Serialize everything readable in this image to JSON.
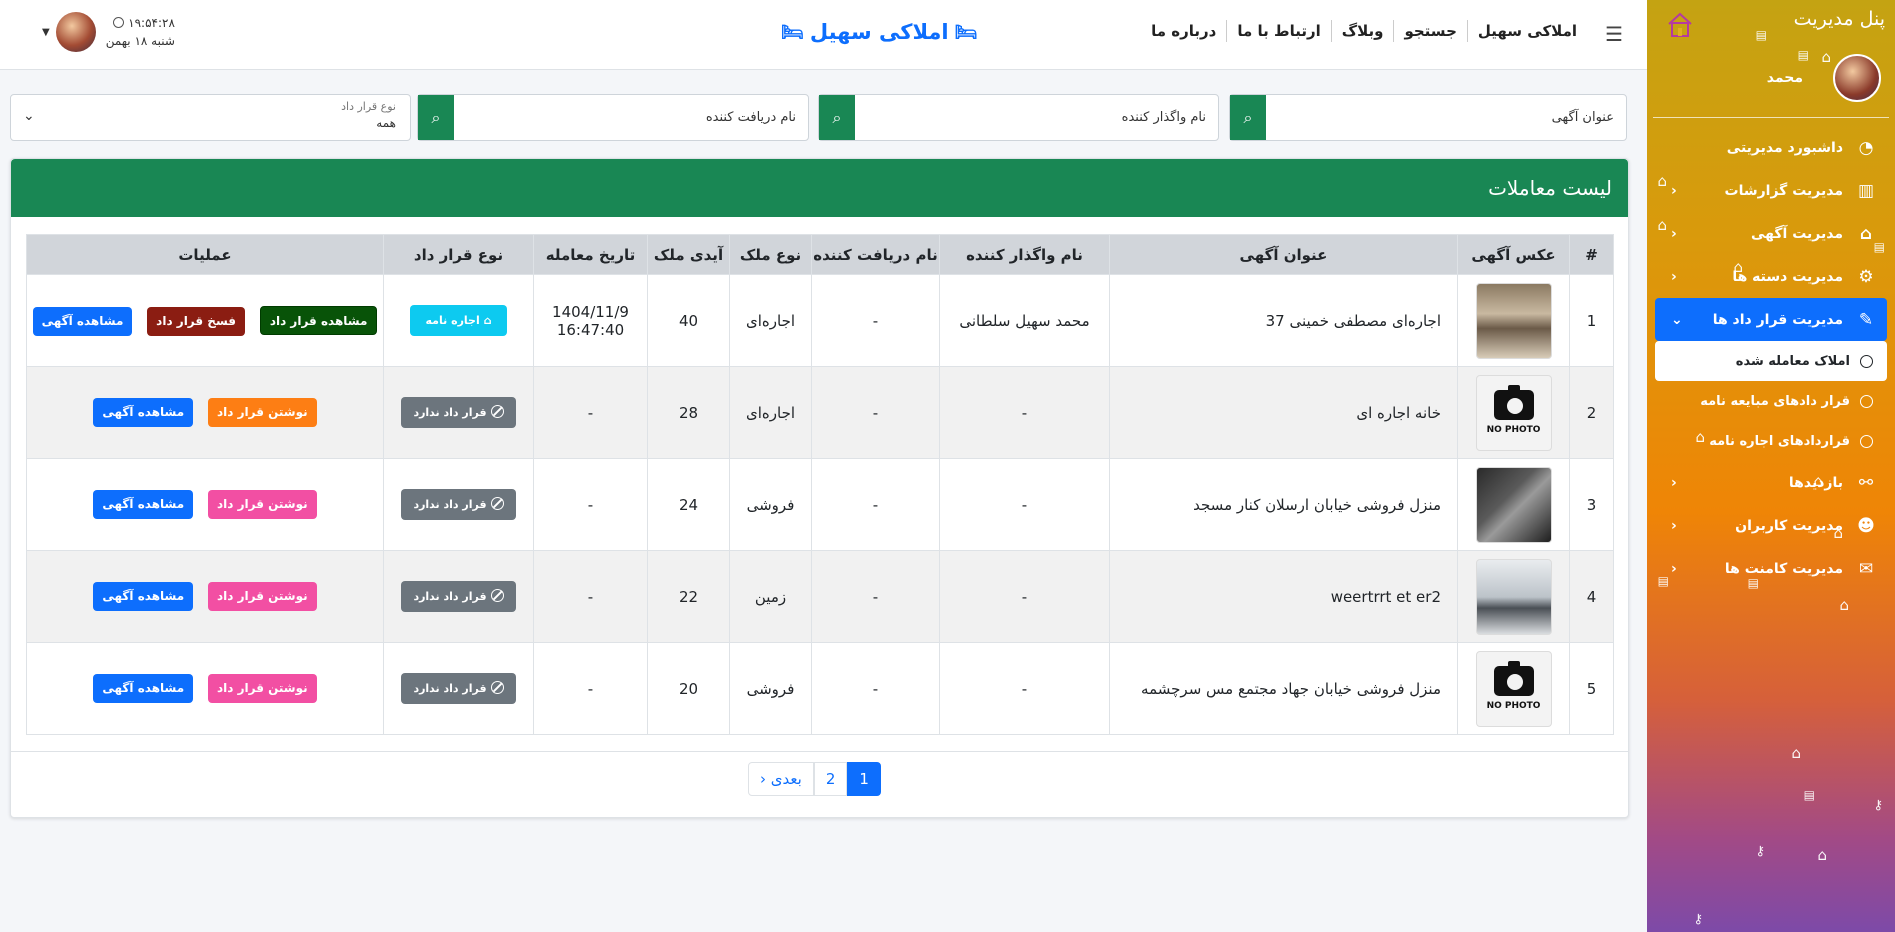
{
  "sidebar": {
    "title": "پنل مدیریت",
    "username": "محمد",
    "items": [
      {
        "label": "داشبورد مدیریتی",
        "icon": "gauge-icon"
      },
      {
        "label": "مدیریت گزارشات",
        "icon": "bar-chart-icon"
      },
      {
        "label": "مدیریت آگهی",
        "icon": "house-icon"
      },
      {
        "label": "مدیریت دسته ها",
        "icon": "gear-icon"
      },
      {
        "label": "مدیریت قرار داد ها",
        "icon": "edit-icon"
      },
      {
        "label": "بازدیدها",
        "icon": "binoculars-icon"
      },
      {
        "label": "مدیریت کاربران",
        "icon": "users-icon"
      },
      {
        "label": "مدیریت کامنت ها",
        "icon": "envelope-icon"
      }
    ],
    "subitems": [
      "املاک معامله شده",
      "قرار دادهای مبایعه نامه",
      "قراردادهای اجاره نامه"
    ]
  },
  "topbar": {
    "nav": [
      "املاکی سهیل",
      "جستجو",
      "وبلاگ",
      "ارتباط با ما",
      "درباره ما"
    ],
    "brand": "املاکی سهیل",
    "time": "۱۹:۵۴:۲۸",
    "date": "شنبه ۱۸ بهمن"
  },
  "filters": {
    "ad_title": "عنوان آگهی",
    "seller": "نام واگذار کننده",
    "buyer": "نام دریافت کننده",
    "contract_type_label": "نوع قرار داد",
    "contract_type_value": "همه"
  },
  "card": {
    "title": "لیست معاملات",
    "columns": [
      "#",
      "عکس آگهی",
      "عنوان آگهی",
      "نام واگذار کننده",
      "نام دریافت کننده",
      "نوع ملک",
      "آیدی ملک",
      "تاریخ معامله",
      "نوع قرار داد",
      "عملیات"
    ],
    "rows": [
      {
        "num": "1",
        "title": "اجاره‌ای مصطفی خمینی 37",
        "seller": "محمد سهیل سلطانی",
        "buyer": "-",
        "type": "اجاره‌ای",
        "id": "40",
        "date1": "1404/11/9",
        "date2": "16:47:40",
        "contract": "اجاره نامه",
        "btn1": "مشاهده قرار داد",
        "btn2": "فسخ قرار داد",
        "btn3": "مشاهده آگهی"
      },
      {
        "num": "2",
        "title": "خانه اجاره ای",
        "seller": "-",
        "buyer": "-",
        "type": "اجاره‌ای",
        "id": "28",
        "date1": "-",
        "date2": "",
        "contract": "قرار داد ندارد",
        "btn2": "نوشتن قرار داد",
        "btn3": "مشاهده آگهی"
      },
      {
        "num": "3",
        "title": "منزل فروشی خیابان ارسلان کنار مسجد",
        "seller": "-",
        "buyer": "-",
        "type": "فروشی",
        "id": "24",
        "date1": "-",
        "date2": "",
        "contract": "قرار داد ندارد",
        "btn2": "نوشتن قرار داد",
        "btn3": "مشاهده آگهی"
      },
      {
        "num": "4",
        "title": "weertrrt et er2",
        "seller": "-",
        "buyer": "-",
        "type": "زمین",
        "id": "22",
        "date1": "-",
        "date2": "",
        "contract": "قرار داد ندارد",
        "btn2": "نوشتن قرار داد",
        "btn3": "مشاهده آگهی"
      },
      {
        "num": "5",
        "title": "منزل فروشی خیابان جهاد مجتمع مس سرچشمه",
        "seller": "-",
        "buyer": "-",
        "type": "فروشی",
        "id": "20",
        "date1": "-",
        "date2": "",
        "contract": "قرار داد ندارد",
        "btn2": "نوشتن قرار داد",
        "btn3": "مشاهده آگهی"
      }
    ],
    "nophoto": "NO PHOTO"
  },
  "pagination": {
    "pages": [
      "1",
      "2"
    ],
    "next": "بعدی",
    "current": "1"
  },
  "colors": {
    "primary": "#0d6efd",
    "success": "#198754"
  }
}
